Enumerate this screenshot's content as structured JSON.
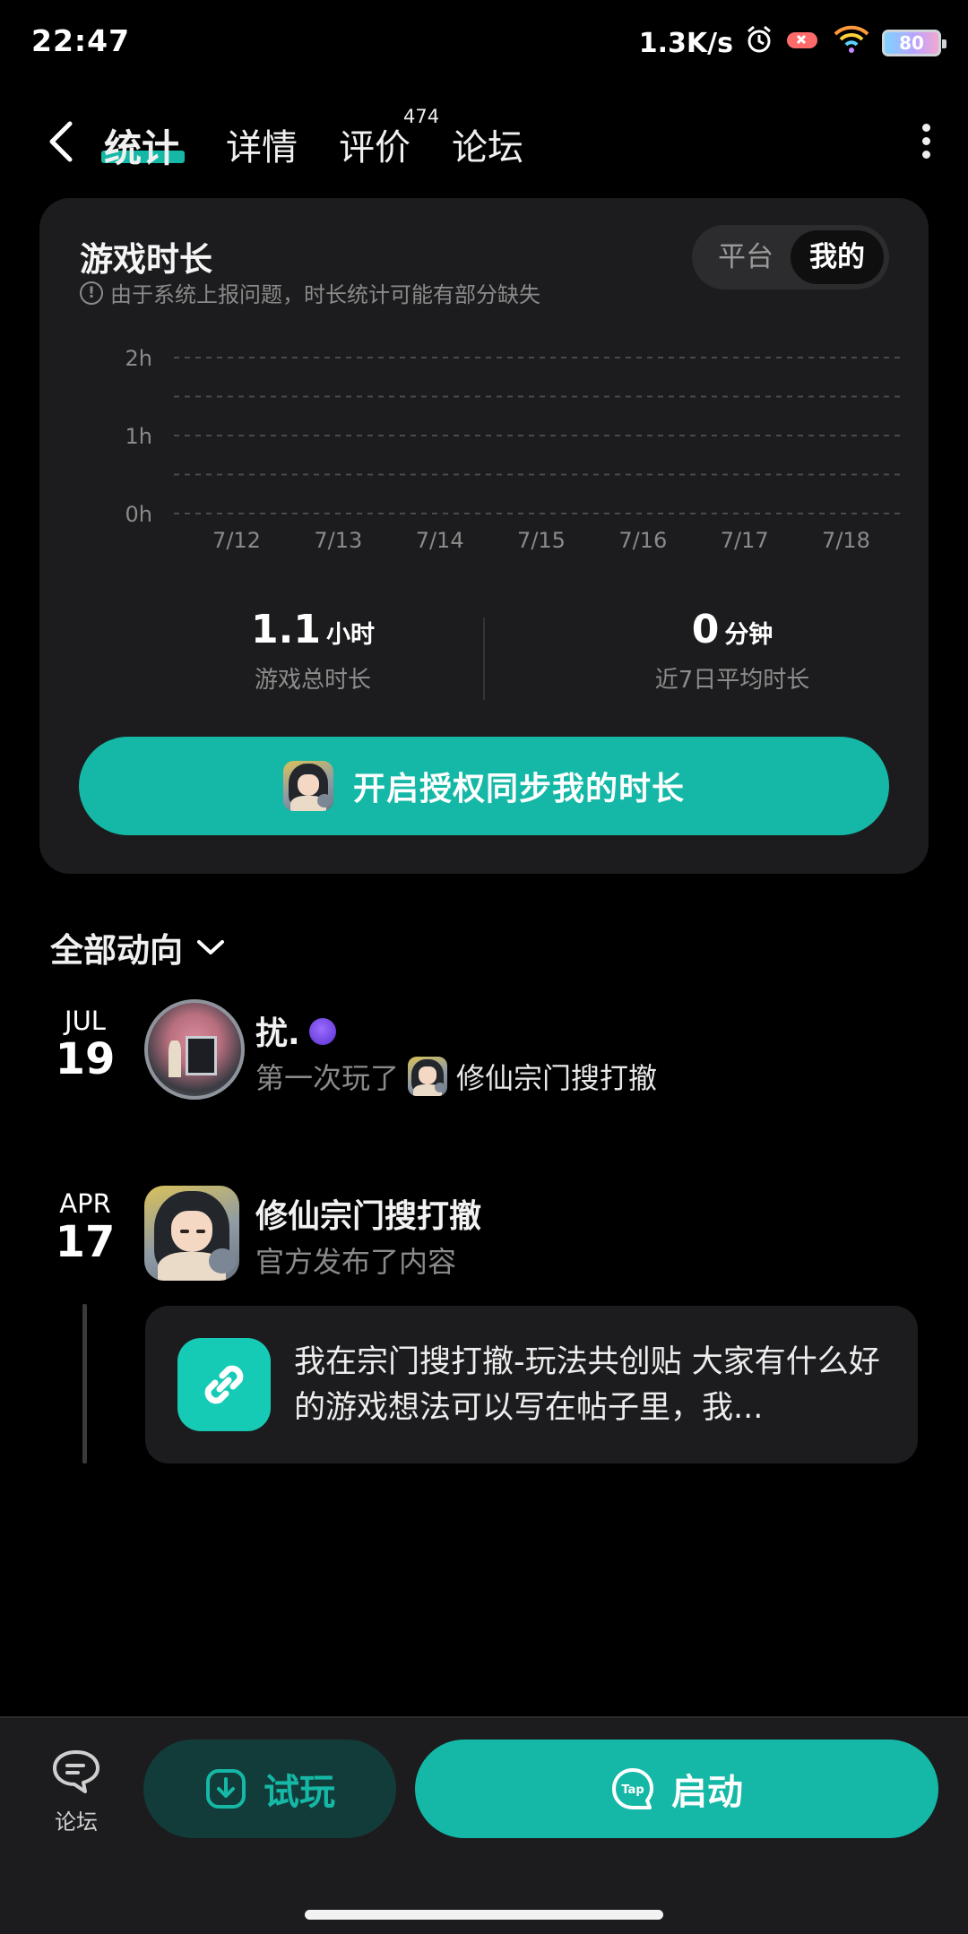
{
  "status_bar": {
    "time": "22:47",
    "net_speed": "1.3K/s",
    "battery": "80"
  },
  "tabs": [
    {
      "label": "统计",
      "active": true
    },
    {
      "label": "详情",
      "active": false
    },
    {
      "label": "评价",
      "active": false,
      "badge": "474"
    },
    {
      "label": "论坛",
      "active": false
    }
  ],
  "stats_card": {
    "title": "游戏时长",
    "notice": "由于系统上报问题，时长统计可能有部分缺失",
    "toggle": {
      "options": [
        "平台",
        "我的"
      ],
      "selected": "我的"
    },
    "total": {
      "value": "1.1",
      "unit": "小时",
      "label": "游戏总时长"
    },
    "avg": {
      "value": "0",
      "unit": "分钟",
      "label": "近7日平均时长"
    },
    "auth_button": "开启授权同步我的时长"
  },
  "chart_data": {
    "type": "bar",
    "categories": [
      "7/12",
      "7/13",
      "7/14",
      "7/15",
      "7/16",
      "7/17",
      "7/18"
    ],
    "values": [
      0,
      0,
      0,
      0,
      0,
      0,
      0
    ],
    "y_ticks": [
      "2h",
      "1h",
      "0h"
    ],
    "ylim": [
      0,
      2
    ],
    "grid": true
  },
  "feed": {
    "filter_label": "全部动向",
    "items": [
      {
        "month": "JUL",
        "day": "19",
        "name": "扰.",
        "action": "第一次玩了",
        "game": "修仙宗门搜打撤"
      },
      {
        "month": "APR",
        "day": "17",
        "name": "修仙宗门搜打撤",
        "action": "官方发布了内容",
        "post_text": "我在宗门搜打撤-玩法共创贴 大家有什么好的游戏想法可以写在帖子里，我..."
      }
    ]
  },
  "bottom_bar": {
    "forum_label": "论坛",
    "try_label": "试玩",
    "launch_label": "启动",
    "tap_logo": "Tap"
  },
  "colors": {
    "accent": "#15b8a6",
    "card_bg": "#1c1c1e",
    "background": "#000000"
  }
}
